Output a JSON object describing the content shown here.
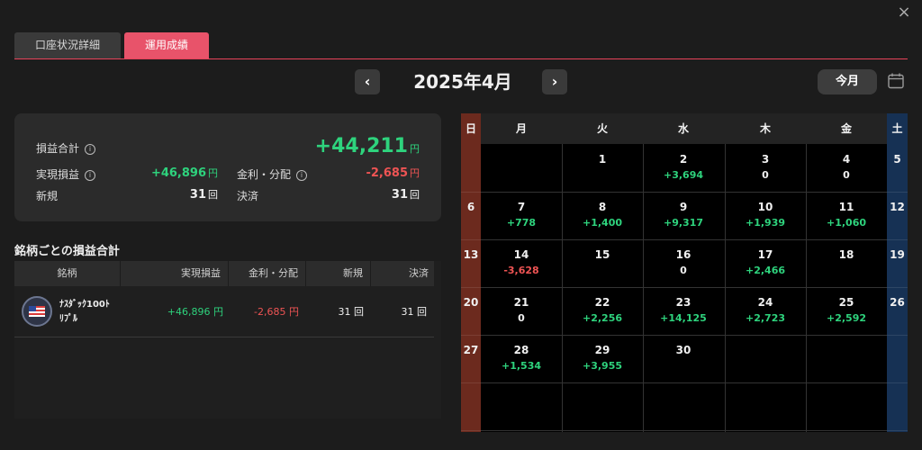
{
  "close_label": "×",
  "tabs": [
    {
      "label": "口座状況詳細",
      "active": false
    },
    {
      "label": "運用成績",
      "active": true
    }
  ],
  "month_nav": {
    "prev_label": "‹",
    "title": "2025年4月",
    "next_label": "›",
    "today_label": "今月"
  },
  "summary": {
    "total_label": "損益合計",
    "total_value": "+44,211",
    "realized_label": "実現損益",
    "realized_value": "+46,896",
    "dividend_label": "金利・分配",
    "dividend_value": "-2,685",
    "new_label": "新規",
    "new_value": "31",
    "settle_label": "決済",
    "settle_value": "31",
    "unit_yen": "円",
    "unit_count": "回",
    "info_glyph": "i"
  },
  "section_title": "銘柄ごとの損益合計",
  "table": {
    "headers": [
      "銘柄",
      "実現損益",
      "金利・分配",
      "新規",
      "決済"
    ],
    "rows": [
      {
        "name": "ﾅｽﾀﾞｯｸ100ﾄﾘﾌﾟﾙ",
        "name_line1": "ﾅｽﾀﾞｯｸ100ﾄ",
        "name_line2": "ﾘﾌﾟﾙ",
        "realized": "+46,896 円",
        "dividend": "-2,685 円",
        "new": "31 回",
        "settle": "31 回"
      }
    ]
  },
  "calendar": {
    "weekdays": [
      "日",
      "月",
      "火",
      "水",
      "木",
      "金",
      "土"
    ],
    "weeks": [
      {
        "sun": "",
        "days": [
          {
            "d": "",
            "v": "",
            "c": ""
          },
          {
            "d": "1",
            "v": "",
            "c": ""
          },
          {
            "d": "2",
            "v": "+3,694",
            "c": "green"
          },
          {
            "d": "3",
            "v": "0",
            "c": "white"
          },
          {
            "d": "4",
            "v": "0",
            "c": "white"
          }
        ],
        "sat": "5"
      },
      {
        "sun": "6",
        "days": [
          {
            "d": "7",
            "v": "+778",
            "c": "green"
          },
          {
            "d": "8",
            "v": "+1,400",
            "c": "green"
          },
          {
            "d": "9",
            "v": "+9,317",
            "c": "green"
          },
          {
            "d": "10",
            "v": "+1,939",
            "c": "green"
          },
          {
            "d": "11",
            "v": "+1,060",
            "c": "green"
          }
        ],
        "sat": "12"
      },
      {
        "sun": "13",
        "days": [
          {
            "d": "14",
            "v": "-3,628",
            "c": "red"
          },
          {
            "d": "15",
            "v": "",
            "c": ""
          },
          {
            "d": "16",
            "v": "0",
            "c": "white"
          },
          {
            "d": "17",
            "v": "+2,466",
            "c": "green"
          },
          {
            "d": "18",
            "v": "",
            "c": ""
          }
        ],
        "sat": "19"
      },
      {
        "sun": "20",
        "days": [
          {
            "d": "21",
            "v": "0",
            "c": "white"
          },
          {
            "d": "22",
            "v": "+2,256",
            "c": "green"
          },
          {
            "d": "23",
            "v": "+14,125",
            "c": "green"
          },
          {
            "d": "24",
            "v": "+2,723",
            "c": "green"
          },
          {
            "d": "25",
            "v": "+2,592",
            "c": "green"
          }
        ],
        "sat": "26"
      },
      {
        "sun": "27",
        "days": [
          {
            "d": "28",
            "v": "+1,534",
            "c": "green"
          },
          {
            "d": "29",
            "v": "+3,955",
            "c": "green"
          },
          {
            "d": "30",
            "v": "",
            "c": ""
          },
          {
            "d": "",
            "v": "",
            "c": ""
          },
          {
            "d": "",
            "v": "",
            "c": ""
          }
        ],
        "sat": ""
      },
      {
        "sun": "",
        "days": [
          {
            "d": "",
            "v": "",
            "c": ""
          },
          {
            "d": "",
            "v": "",
            "c": ""
          },
          {
            "d": "",
            "v": "",
            "c": ""
          },
          {
            "d": "",
            "v": "",
            "c": ""
          },
          {
            "d": "",
            "v": "",
            "c": ""
          }
        ],
        "sat": ""
      }
    ]
  },
  "colors": {
    "accent": "#e8536a",
    "positive": "#2ed37d",
    "negative": "#ef5454",
    "sunday": "#6c2a1e",
    "saturday": "#163154"
  }
}
